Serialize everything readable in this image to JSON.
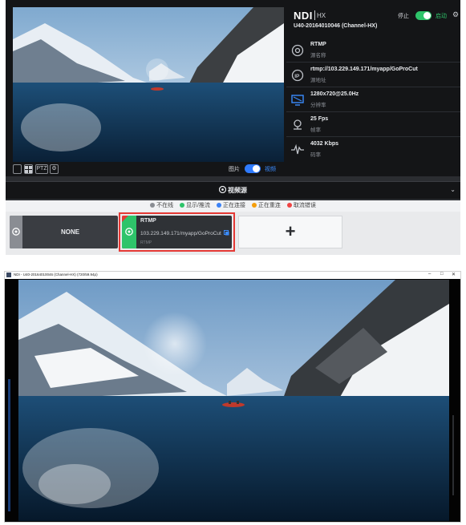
{
  "header": {
    "brand": "NDI",
    "brand_suffix": "HX",
    "device_name": "U40-20164010046 (Channel-HX)",
    "stop_label": "停止",
    "start_label": "启动"
  },
  "info_rows": [
    {
      "value": "RTMP",
      "label": "源名称",
      "icon": "source-icon"
    },
    {
      "value": "rtmp://103.229.149.171/myapp/GoProCut",
      "label": "源地址",
      "icon": "ip-icon"
    },
    {
      "value": "1280x720@25.0Hz",
      "label": "分辨率",
      "icon": "monitor-icon"
    },
    {
      "value": "25 Fps",
      "label": "帧率",
      "icon": "framerate-icon"
    },
    {
      "value": "4032 Kbps",
      "label": "码率",
      "icon": "bitrate-icon"
    }
  ],
  "toolbar": {
    "ptz_label": "PTZ",
    "image_label": "图片",
    "video_label": "视频"
  },
  "sources_section": {
    "title": "视频源",
    "legend": [
      {
        "label": "不在线",
        "color": "#8a8d93"
      },
      {
        "label": "显示/推流",
        "color": "#2ec46a"
      },
      {
        "label": "正在连接",
        "color": "#3b82f6"
      },
      {
        "label": "正在重连",
        "color": "#f59e0b"
      },
      {
        "label": "取流错误",
        "color": "#ef4444"
      }
    ],
    "cards": [
      {
        "title": "NONE"
      },
      {
        "title": "RTMP",
        "url": "103.229.149.171/myapp/GoProCut",
        "type": "RTMP"
      }
    ],
    "add_label": "+"
  },
  "window": {
    "title": "NDI - U40-20164010046 (Channel-HX) (720/59.94p)",
    "controls": [
      "–",
      "□",
      "✕"
    ]
  },
  "colors": {
    "accent_green": "#2ec46a",
    "accent_blue": "#2f7bff",
    "selected_border": "#e53935"
  }
}
